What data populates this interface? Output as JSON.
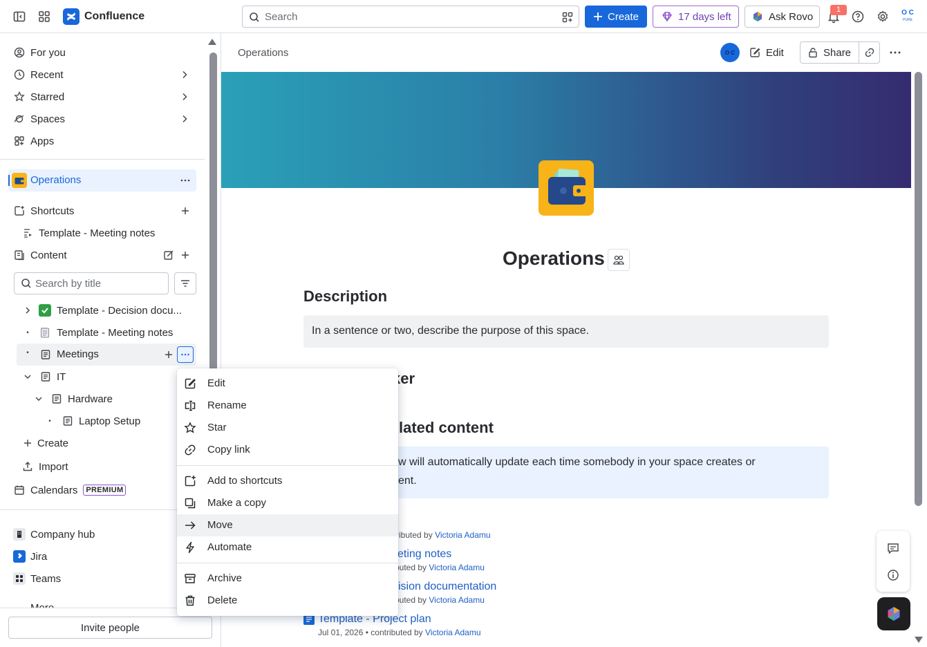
{
  "topbar": {
    "app_name": "Confluence",
    "search_placeholder": "Search",
    "create_label": "Create",
    "trial_label": "17 days left",
    "rovo_label": "Ask Rovo",
    "notification_count": "1",
    "avatar_initials": "O C",
    "avatar_sub": "PURE"
  },
  "sidebar": {
    "nav": [
      {
        "label": "For you"
      },
      {
        "label": "Recent"
      },
      {
        "label": "Starred"
      },
      {
        "label": "Spaces"
      },
      {
        "label": "Apps"
      }
    ],
    "space_name": "Operations",
    "shortcuts_label": "Shortcuts",
    "shortcut_item": "Template - Meeting notes",
    "content_label": "Content",
    "search_title_placeholder": "Search by title",
    "tree": [
      {
        "label": "Template - Decision docu..."
      },
      {
        "label": "Template - Meeting notes"
      },
      {
        "label": "Meetings"
      },
      {
        "label": "IT"
      },
      {
        "label": "Hardware"
      },
      {
        "label": "Laptop Setup"
      }
    ],
    "create_label": "Create",
    "import_label": "Import",
    "calendars_label": "Calendars",
    "premium_badge": "PREMIUM",
    "apps": [
      {
        "label": "Company hub"
      },
      {
        "label": "Jira"
      },
      {
        "label": "Teams"
      },
      {
        "label": "More"
      }
    ],
    "invite_label": "Invite people"
  },
  "page": {
    "breadcrumb": "Operations",
    "edit_label": "Edit",
    "share_label": "Share",
    "title": "Operations",
    "description_heading": "Description",
    "description_text": "In a sentence or two, describe the purpose of this space.",
    "heading2_visible": "ker",
    "heading3_visible": "lated content",
    "info_line1": "w will automatically update each time somebody in your space creates or",
    "info_line2": "ent.",
    "recent": [
      {
        "title": "",
        "meta_date": "",
        "meta_text": "ntributed by",
        "author": "Victoria Adamu"
      },
      {
        "title": "eting notes",
        "meta_date": "",
        "meta_text": "buted by",
        "author": "Victoria Adamu"
      },
      {
        "title": "ision documentation",
        "meta_date": "",
        "meta_text": "buted by",
        "author": "Victoria Adamu"
      },
      {
        "title": "Template - Project plan",
        "meta_date": "Jul 01, 2026",
        "meta_text": "• contributed by",
        "author": "Victoria Adamu"
      }
    ]
  },
  "context_menu": {
    "items": [
      {
        "label": "Edit"
      },
      {
        "label": "Rename"
      },
      {
        "label": "Star"
      },
      {
        "label": "Copy link"
      },
      {
        "label": "Add to shortcuts"
      },
      {
        "label": "Make a copy"
      },
      {
        "label": "Move"
      },
      {
        "label": "Automate"
      },
      {
        "label": "Archive"
      },
      {
        "label": "Delete"
      }
    ]
  },
  "colors": {
    "accent": "#1868db",
    "trial": "#6e3fb4",
    "link": "#1d5fc4",
    "notification": "#f87168"
  }
}
